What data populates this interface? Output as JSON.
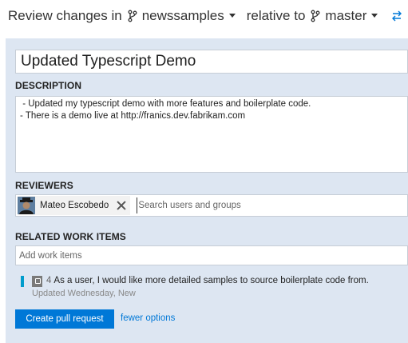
{
  "header": {
    "prefix": "Review changes in",
    "source_branch": "newssamples",
    "relative_text": "relative to",
    "target_branch": "master",
    "swap_icon": "swap-arrows-icon",
    "branch_icon": "git-branch-icon"
  },
  "form": {
    "title_value": "Updated Typescript Demo",
    "description_label": "DESCRIPTION",
    "description_lines": [
      " - Updated my typescript demo with more features and boilerplate code.",
      "- There is a demo live at http://franics.dev.fabrikam.com"
    ],
    "reviewers_label": "REVIEWERS",
    "reviewer_name": "Mateo Escobedo",
    "reviewers_placeholder": "Search users and groups",
    "work_items_label": "RELATED WORK ITEMS",
    "work_items_placeholder": "Add work items",
    "work_item": {
      "id": "4",
      "title": "As a user, I would like more detailed samples to source boilerplate code from.",
      "subtitle": "Updated Wednesday, New",
      "color": "#009ccc",
      "icon": "backlog-item-icon"
    },
    "create_button": "Create pull request",
    "fewer_options": "fewer options"
  },
  "colors": {
    "accent": "#0078d7",
    "panel_bg": "#dde6f2"
  }
}
